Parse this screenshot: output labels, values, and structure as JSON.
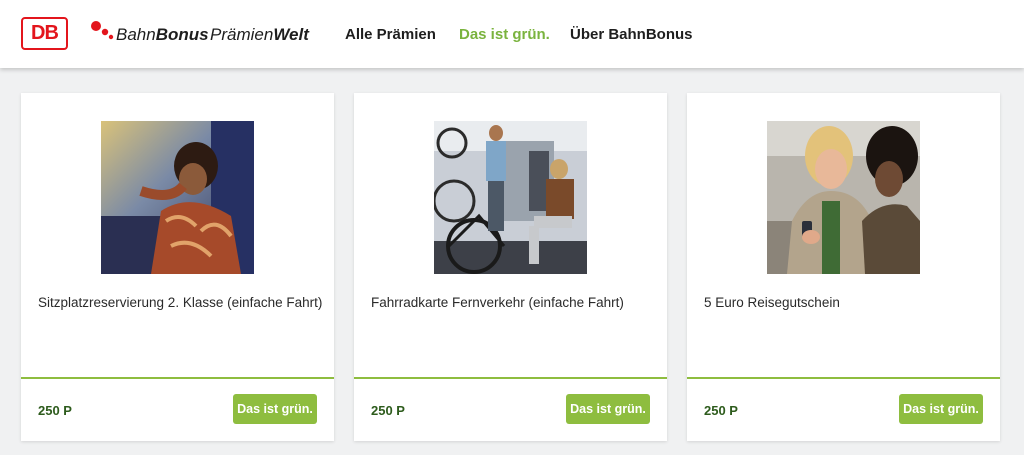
{
  "header": {
    "logo_text": "DB",
    "brand_name_regular": "Bahn",
    "brand_name_bold": "Bonus",
    "subbrand_regular": "Prämien",
    "subbrand_bold": "Welt",
    "nav": [
      {
        "label": "Alle Prämien",
        "active": false
      },
      {
        "label": "Das ist grün.",
        "active": true
      },
      {
        "label": "Über BahnBonus",
        "active": false
      }
    ]
  },
  "cards": [
    {
      "title": "Sitzplatzreservierung 2. Klasse (einfache Fahrt)",
      "points": "250 P",
      "button": "Das ist grün."
    },
    {
      "title": "Fahrradkarte Fernverkehr (einfache Fahrt)",
      "points": "250 P",
      "button": "Das ist grün."
    },
    {
      "title": "5 Euro Reisegutschein",
      "points": "250 P",
      "button": "Das ist grün."
    }
  ],
  "colors": {
    "accent_green": "#8ebd3f",
    "nav_active": "#7ab33e",
    "points_text": "#2d5b1c",
    "db_red": "#e3151c"
  }
}
